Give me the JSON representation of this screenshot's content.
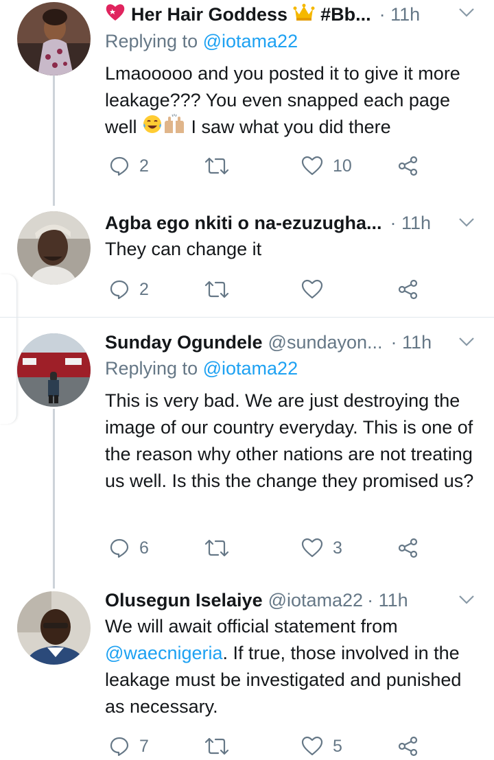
{
  "tweets": [
    {
      "name": "Her Hair Goddess",
      "name_suffix": "#Bb...",
      "handle": "",
      "time": "11h",
      "replying_prefix": "Replying to",
      "replying_handle": "@iotama22",
      "text_part1": "Lmaooooo and you posted it to give it more leakage??? You even snapped each page well",
      "text_part2": " I saw what you did there",
      "emoji": [
        "heart-sparkle",
        "crown",
        "tears-of-joy",
        "raised-hands"
      ],
      "replies": "2",
      "retweets": "",
      "likes": "10"
    },
    {
      "name": "Agba ego nkiti o na-ezuzugha...",
      "handle": "",
      "time": "11h",
      "text": "They can change it",
      "replies": "2",
      "retweets": "",
      "likes": ""
    },
    {
      "name": "Sunday Ogundele",
      "handle": "@sundayon...",
      "time": "11h",
      "replying_prefix": "Replying to",
      "replying_handle": "@iotama22",
      "text": "This is very bad. We are just destroying the image of our country everyday. This is one of the reason why other nations are not treating us well. Is this the change they promised us?",
      "replies": "6",
      "retweets": "",
      "likes": "3"
    },
    {
      "name": "Olusegun Iselaiye",
      "handle": "@iotama22",
      "time": "11h",
      "text_part1": "We will await official statement from ",
      "mention": "@waecnigeria",
      "text_part2": ". If true, those involved in the leakage must be investigated and punished as necessary.",
      "replies": "7",
      "retweets": "",
      "likes": "5"
    }
  ],
  "colors": {
    "link": "#1da1f2",
    "secondary": "#657786",
    "text": "#14171a",
    "divider": "#e1e8ed",
    "thread": "#cdd3d9"
  },
  "icons": [
    "reply-icon",
    "retweet-icon",
    "like-icon",
    "share-icon",
    "chevron-down-icon"
  ]
}
